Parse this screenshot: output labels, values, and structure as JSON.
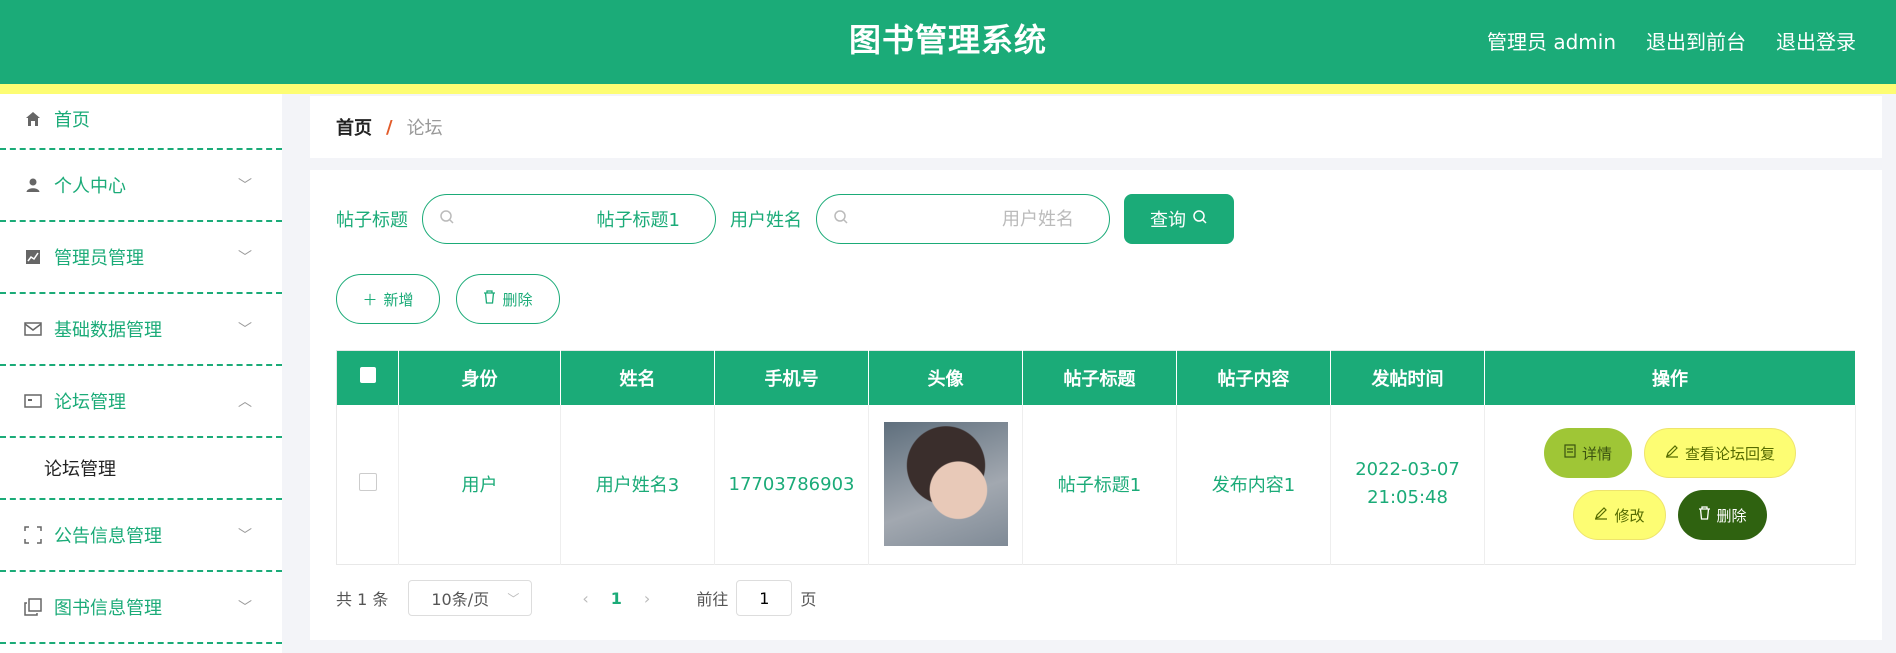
{
  "header": {
    "title": "图书管理系统",
    "user_label": "管理员 admin",
    "front_link": "退出到前台",
    "logout_link": "退出登录"
  },
  "sidebar": {
    "items": [
      {
        "label": "首页",
        "icon": "home-icon"
      },
      {
        "label": "个人中心",
        "icon": "user-icon"
      },
      {
        "label": "管理员管理",
        "icon": "chart-icon"
      },
      {
        "label": "基础数据管理",
        "icon": "mail-icon"
      },
      {
        "label": "论坛管理",
        "icon": "card-icon"
      },
      {
        "label": "公告信息管理",
        "icon": "frame-icon"
      },
      {
        "label": "图书信息管理",
        "icon": "copy-icon"
      }
    ],
    "submenu_label": "论坛管理"
  },
  "breadcrumb": {
    "home": "首页",
    "separator": "/",
    "current": "论坛"
  },
  "search": {
    "title_label": "帖子标题",
    "title_value": "帖子标题1",
    "name_label": "用户姓名",
    "name_placeholder": "用户姓名",
    "query_label": "查询"
  },
  "actions": {
    "add_label": "新增",
    "delete_label": "删除"
  },
  "table": {
    "headers": [
      "身份",
      "姓名",
      "手机号",
      "头像",
      "帖子标题",
      "帖子内容",
      "发帖时间",
      "操作"
    ],
    "rows": [
      {
        "role": "用户",
        "name": "用户姓名3",
        "phone": "17703786903",
        "title": "帖子标题1",
        "content": "发布内容1",
        "time": "2022-03-07 21:05:48"
      }
    ],
    "op_detail": "详情",
    "op_view": "查看论坛回复",
    "op_edit": "修改",
    "op_delete": "删除"
  },
  "pager": {
    "total": "共 1 条",
    "page_size": "10条/页",
    "current": "1",
    "goto_prefix": "前往",
    "goto_value": "1",
    "goto_suffix": "页"
  },
  "colors": {
    "primary": "#1bab78",
    "stripe": "#fdfd73",
    "danger": "#2f6210",
    "detail": "#9fc636"
  }
}
